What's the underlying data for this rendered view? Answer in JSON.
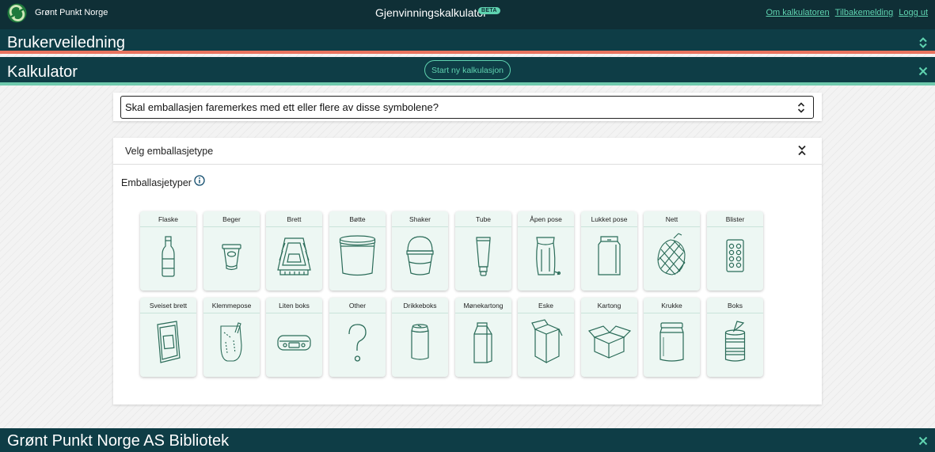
{
  "header": {
    "brand_name": "Grønt Punkt Norge",
    "app_title": "Gjenvinningskalkulator",
    "beta_label": "BETA",
    "links": [
      "Om kalkulatoren",
      "Tilbakemelding",
      "Logg ut"
    ]
  },
  "guide": {
    "title": "Brukerveiledning",
    "icon": "chevron-up-down-icon"
  },
  "calculator": {
    "title": "Kalkulator",
    "start_button_label": "Start ny kalkulasjon",
    "icon": "close-icon",
    "question": "Skal emballasjen faremerkes med ett eller flere av disse symbolene?",
    "select_type_title": "Velg emballasjetype",
    "packaging_types_label": "Emballasjetyper",
    "packaging_types": [
      {
        "label": "Flaske",
        "icon": "bottle"
      },
      {
        "label": "Beger",
        "icon": "cup"
      },
      {
        "label": "Brett",
        "icon": "tray"
      },
      {
        "label": "Bøtte",
        "icon": "bucket"
      },
      {
        "label": "Shaker",
        "icon": "shaker"
      },
      {
        "label": "Tube",
        "icon": "tube"
      },
      {
        "label": "Åpen pose",
        "icon": "open-bag"
      },
      {
        "label": "Lukket pose",
        "icon": "closed-bag"
      },
      {
        "label": "Nett",
        "icon": "net"
      },
      {
        "label": "Blister",
        "icon": "blister"
      },
      {
        "label": "Sveiset brett",
        "icon": "welded-tray"
      },
      {
        "label": "Klemmepose",
        "icon": "squeeze-pouch"
      },
      {
        "label": "Liten boks",
        "icon": "small-box"
      },
      {
        "label": "Other",
        "icon": "question"
      },
      {
        "label": "Drikkeboks",
        "icon": "can"
      },
      {
        "label": "Mønekartong",
        "icon": "gable-carton"
      },
      {
        "label": "Eske",
        "icon": "box"
      },
      {
        "label": "Kartong",
        "icon": "open-carton"
      },
      {
        "label": "Krukke",
        "icon": "jar"
      },
      {
        "label": "Boks",
        "icon": "tin-can"
      }
    ]
  },
  "library": {
    "title": "Grønt Punkt Norge AS Bibliotek",
    "icon": "close-icon"
  },
  "colors": {
    "header_bg": "#0f2f36",
    "section_bg": "#0e3d46",
    "accent": "#5fd3b0",
    "coral": "#e8735e",
    "tile_bg": "#edf7f3",
    "icon_stroke": "#2a6b58"
  }
}
